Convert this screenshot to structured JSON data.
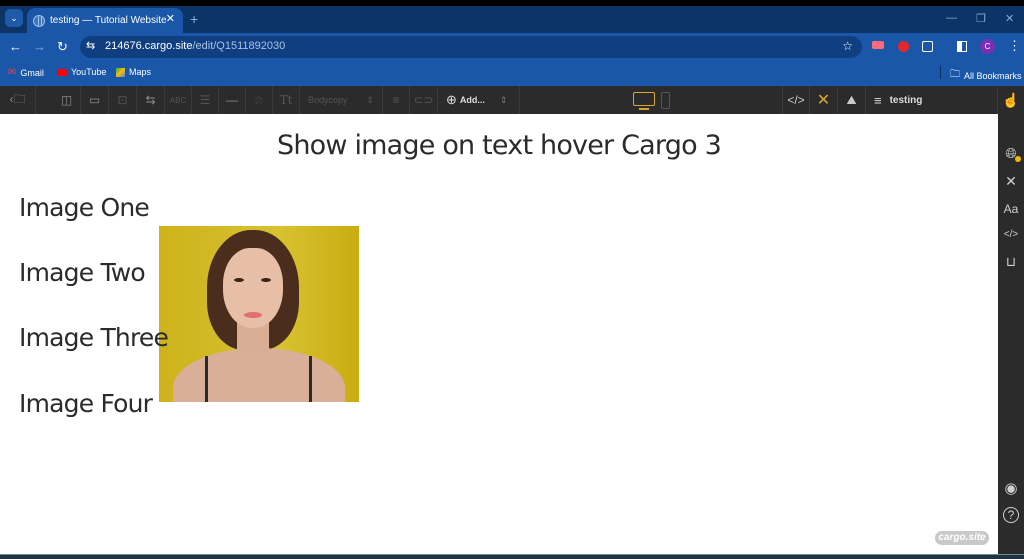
{
  "browser": {
    "tab_title": "testing — Tutorial Website",
    "url_host": "214676.cargo.site",
    "url_path": "/edit/Q1511892030",
    "profile_initial": "C",
    "bookmarks": [
      "Gmail",
      "YouTube",
      "Maps"
    ],
    "all_bookmarks_label": "All Bookmarks"
  },
  "toolbar": {
    "text_style": "Bodycopy",
    "add_label": "Add...",
    "site_name": "testing",
    "accent_color": "#d4a72c"
  },
  "page": {
    "title": "Show image on text hover Cargo 3",
    "items": [
      "Image One",
      "Image Two",
      "Image Three",
      "Image Four"
    ]
  },
  "sidebar": {
    "font_label": "Aa",
    "code_label": "</>"
  },
  "badge": "cargo.site"
}
